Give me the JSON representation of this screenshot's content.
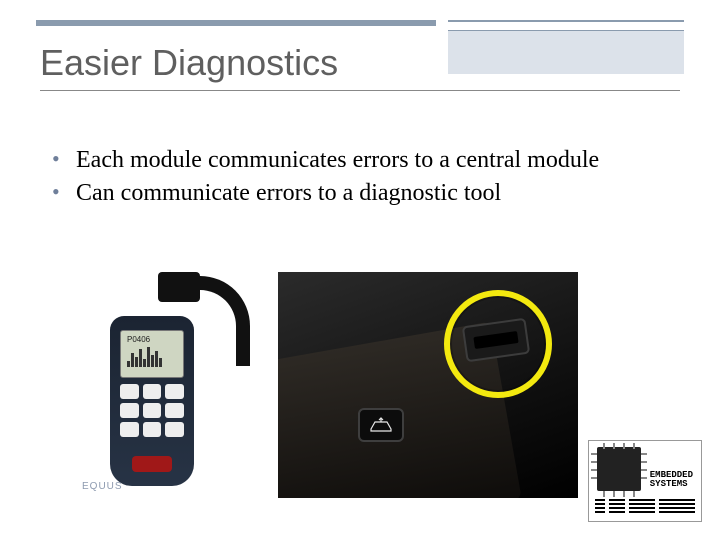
{
  "slide": {
    "title": "Easier Diagnostics",
    "bullets": [
      "Each module communicates errors to a central module",
      "Can communicate errors to a diagnostic tool"
    ]
  },
  "images": {
    "scanner": {
      "name": "obd2-scanner-tool",
      "screen_code": "P0406",
      "watermark": "EQUUS"
    },
    "port_photo": {
      "name": "under-dash-obd-port",
      "highlight": "obd-connector-circled-yellow",
      "hood_release_icon": "car-hood"
    }
  },
  "badge": {
    "line1": "EMBEDDED",
    "line2": "SYSTEMS"
  }
}
